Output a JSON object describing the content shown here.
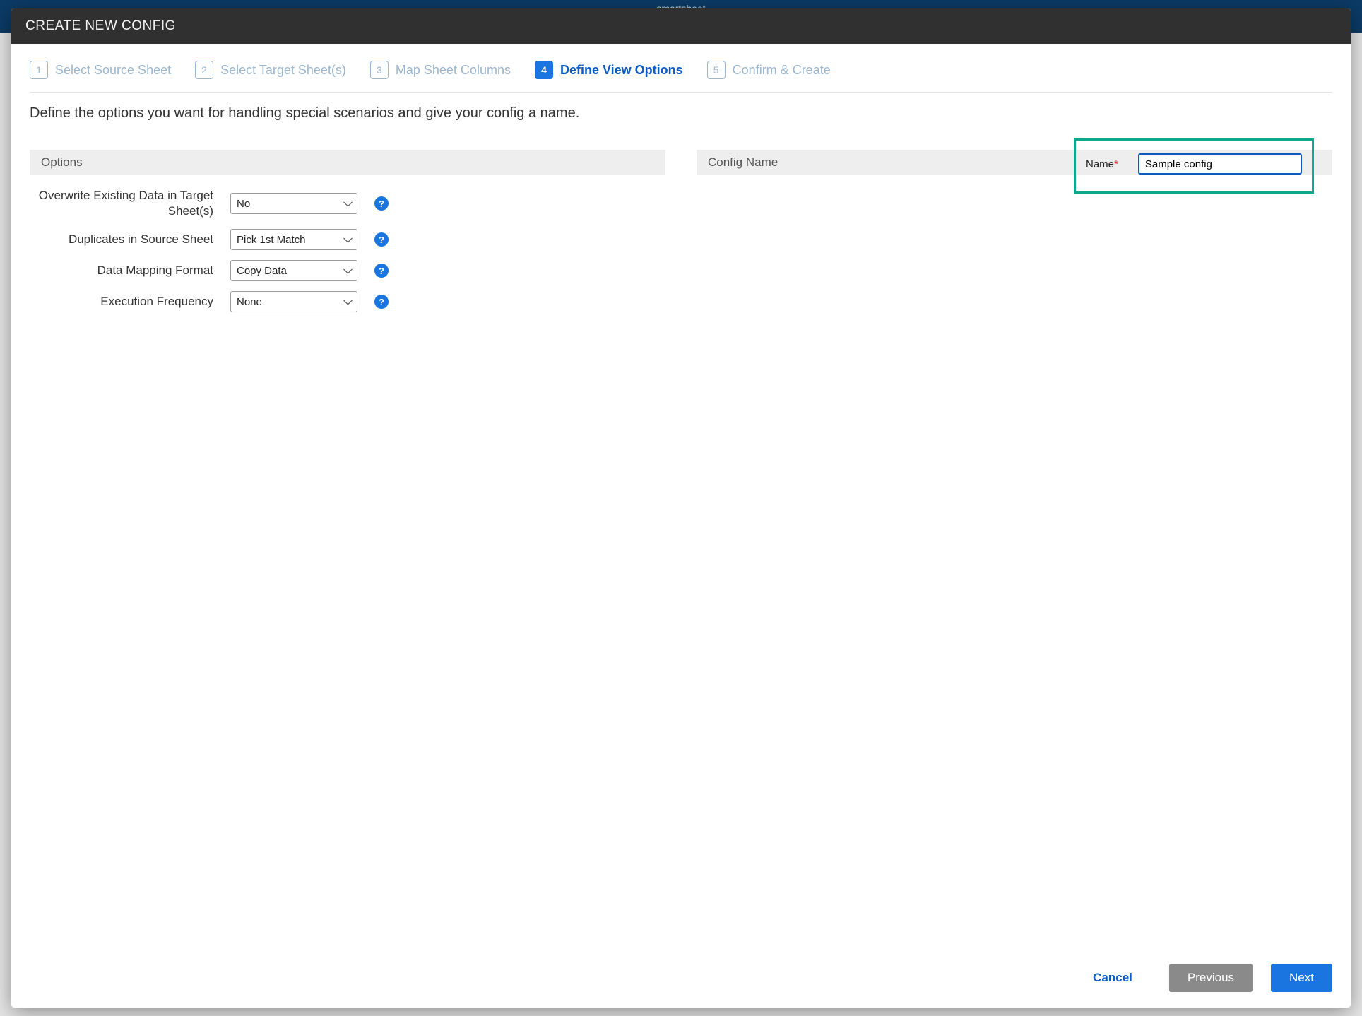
{
  "brand": "smartsheet",
  "modal": {
    "title": "CREATE NEW CONFIG",
    "instructions": "Define the options you want for handling special scenarios and give your config a name."
  },
  "steps": [
    {
      "num": "1",
      "label": "Select Source Sheet",
      "active": false
    },
    {
      "num": "2",
      "label": "Select Target Sheet(s)",
      "active": false
    },
    {
      "num": "3",
      "label": "Map Sheet Columns",
      "active": false
    },
    {
      "num": "4",
      "label": "Define View Options",
      "active": true
    },
    {
      "num": "5",
      "label": "Confirm & Create",
      "active": false
    }
  ],
  "options_header": "Options",
  "options": {
    "overwrite_label": "Overwrite Existing Data in Target Sheet(s)",
    "overwrite_value": "No",
    "dup_label": "Duplicates in Source Sheet",
    "dup_value": "Pick 1st Match",
    "fmt_label": "Data Mapping Format",
    "fmt_value": "Copy Data",
    "freq_label": "Execution Frequency",
    "freq_value": "None"
  },
  "config_header": "Config Name",
  "config": {
    "name_label": "Name",
    "name_value": "Sample config"
  },
  "footer": {
    "cancel": "Cancel",
    "previous": "Previous",
    "next": "Next"
  },
  "help_glyph": "?",
  "required_glyph": "*"
}
